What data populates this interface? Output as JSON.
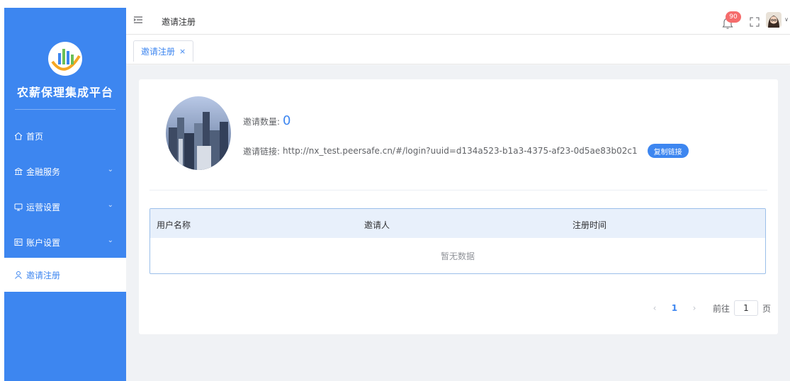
{
  "sidebar": {
    "title": "农薪保理集成平台",
    "items": [
      {
        "label": "首页",
        "icon": "home-icon",
        "has_children": false,
        "active": false
      },
      {
        "label": "金融服务",
        "icon": "bank-icon",
        "has_children": true,
        "active": false
      },
      {
        "label": "运营设置",
        "icon": "operations-icon",
        "has_children": true,
        "active": false
      },
      {
        "label": "账户设置",
        "icon": "account-card-icon",
        "has_children": true,
        "active": false
      },
      {
        "label": "邀请注册",
        "icon": "user-icon",
        "has_children": false,
        "active": true
      }
    ]
  },
  "header": {
    "breadcrumb": "邀请注册",
    "notification_count": "90"
  },
  "tabs": [
    {
      "label": "邀请注册",
      "close": "×"
    }
  ],
  "invite": {
    "count_label": "邀请数量:",
    "count": "0",
    "link_label": "邀请链接:",
    "link": "http://nx_test.peersafe.cn/#/login?uuid=d134a523-b1a3-4375-af23-0d5ae83b02c1",
    "copy_button": "复制链接"
  },
  "table": {
    "columns": [
      "用户名称",
      "邀请人",
      "注册时间"
    ],
    "rows": [],
    "empty_text": "暂无数据"
  },
  "pagination": {
    "prev": "‹",
    "current_page": "1",
    "next": "›",
    "goto_label": "前往",
    "goto_value": "1",
    "page_suffix": "页"
  },
  "colors": {
    "brand": "#3d86f0",
    "badge": "#f56c6c",
    "table_header": "#e8f0fb"
  }
}
